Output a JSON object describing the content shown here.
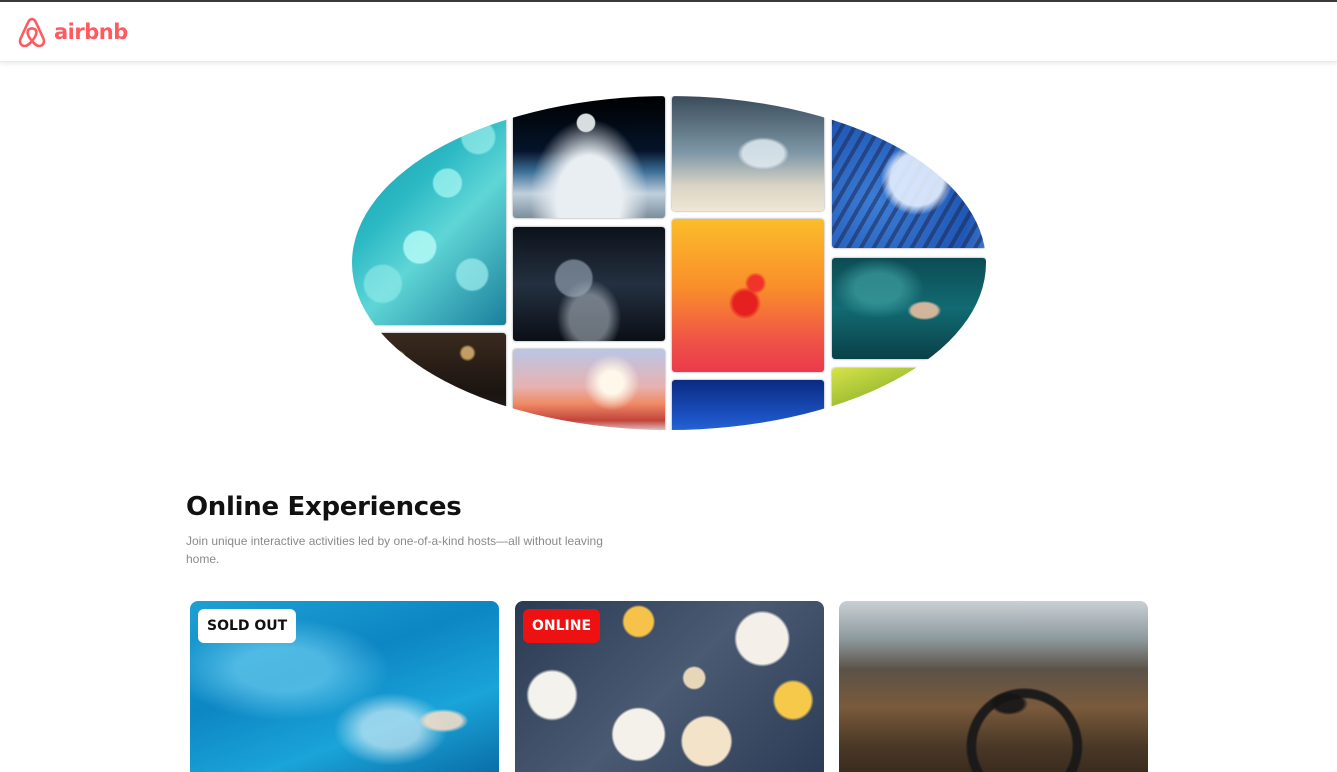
{
  "brand": {
    "name": "airbnb",
    "color": "#ff5a5f",
    "icon": "airbnb-logo-icon"
  },
  "collage": {
    "images": [
      "blue-crystals-image",
      "night-street-car-image",
      "moon-over-clouds-image",
      "ghost-ship-image",
      "pink-sky-clouds-image",
      "ship-in-bottle-image",
      "red-flower-image",
      "blue-sky-image",
      "blue-tiger-image",
      "hand-in-water-image",
      "green-aurora-image"
    ]
  },
  "section": {
    "title": "Online Experiences",
    "description": "Join unique interactive activities led by one-of-a-kind hosts—all without leaving home."
  },
  "cards": [
    {
      "badge": "SOLD OUT",
      "badge_color": "#ffffff",
      "image": "swimmer-pool-image"
    },
    {
      "badge": "ONLINE",
      "badge_color": "#ee1111",
      "image": "breakfast-table-image"
    },
    {
      "badge": "",
      "image": "mountain-bike-image"
    }
  ]
}
